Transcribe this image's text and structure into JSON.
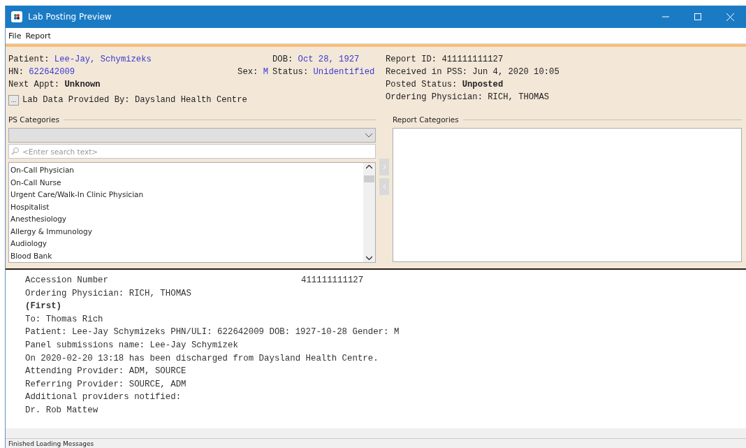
{
  "window": {
    "title": "Lab Posting Preview"
  },
  "menu": [
    {
      "label": "File"
    },
    {
      "label": "Report"
    }
  ],
  "patient": {
    "rows": [
      {
        "main": {
          "label": "Patient:",
          "value": "Lee-Jay, Schymizeks",
          "kind": "link"
        },
        "right": {
          "label": "DOB:",
          "value": "Oct 28, 1927",
          "kind": "link"
        }
      },
      {
        "main": {
          "label": "HN:",
          "value": "622642009",
          "kind": "link"
        },
        "middle": {
          "label": "Sex:",
          "value": "M",
          "kind": "link"
        },
        "right": {
          "label": "Status:",
          "value": "Unidentified",
          "kind": "link"
        }
      },
      {
        "main": {
          "label": "Next Appt:",
          "value": "Unknown",
          "kind": "bold"
        }
      }
    ],
    "provider": {
      "button": "...",
      "text": "Lab Data Provided By: Daysland Health Centre"
    }
  },
  "report_info": [
    {
      "label": "Report ID:",
      "value": "411111111127",
      "kind": "plain"
    },
    {
      "label": "Received in PSS:",
      "value": "Jun 4, 2020 10:05",
      "kind": "plain"
    },
    {
      "label": "Posted Status:",
      "value": "Unposted",
      "kind": "bold"
    },
    {
      "label": "Ordering Physician:",
      "value": "RICH, THOMAS",
      "kind": "plain"
    }
  ],
  "ps_categories": {
    "title": "PS Categories",
    "search": {
      "placeholder": "<Enter search text>"
    },
    "items": [
      {
        "label": "On-Call Physician",
        "selected": false
      },
      {
        "label": "On-Call Nurse",
        "selected": false
      },
      {
        "label": "Urgent Care/Walk-In Clinic Physician",
        "selected": false
      },
      {
        "label": "Hospitalist",
        "selected": false
      },
      {
        "label": "Anesthesiology",
        "selected": false
      },
      {
        "label": "Allergy & Immunology",
        "selected": false
      },
      {
        "label": "Audiology",
        "selected": false
      },
      {
        "label": "Blood Bank",
        "selected": false
      }
    ]
  },
  "move_buttons": [
    {
      "kind": "add",
      "disabled": true
    },
    {
      "kind": "remove",
      "disabled": true
    }
  ],
  "report_categories": {
    "title": "Report Categories"
  },
  "report": {
    "accession": {
      "label": "Accession Number",
      "value": "411111111127"
    },
    "lines": [
      {
        "text": "Ordering Physician: RICH, THOMAS",
        "bold": false
      },
      {
        "text": "(First)",
        "bold": true
      },
      {
        "text": "To: Thomas Rich",
        "bold": false
      },
      {
        "text": "Patient: Lee-Jay Schymizeks PHN/ULI: 622642009 DOB: 1927-10-28 Gender: M",
        "bold": false
      },
      {
        "text": "Panel submissions name: Lee-Jay Schymizek",
        "bold": false
      },
      {
        "text": "On 2020-02-20 13:18 has been discharged from Daysland Health Centre.",
        "bold": false
      },
      {
        "text": "Attending Provider: ADM, SOURCE",
        "bold": false
      },
      {
        "text": "Referring Provider: SOURCE, ADM",
        "bold": false
      },
      {
        "text": "Additional providers notified:",
        "bold": false
      },
      {
        "text": "Dr. Rob Mattew",
        "bold": false
      }
    ]
  },
  "status_bar": "Finished Loading Messages"
}
